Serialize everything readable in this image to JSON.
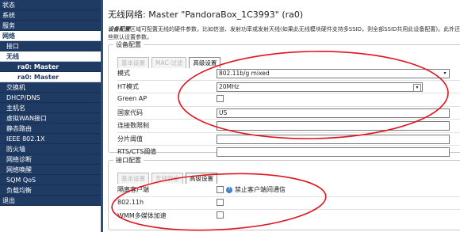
{
  "sidebar": {
    "items": [
      {
        "label": "状态",
        "level": 0,
        "state": "normal"
      },
      {
        "label": "系统",
        "level": 0,
        "state": "normal"
      },
      {
        "label": "服务",
        "level": 0,
        "state": "normal"
      },
      {
        "label": "网络",
        "level": 0,
        "state": "active"
      },
      {
        "label": "接口",
        "level": 1,
        "state": "normal"
      },
      {
        "label": "无线",
        "level": 1,
        "state": "active"
      },
      {
        "label": "ra0: Master",
        "level": 2,
        "state": "normal"
      },
      {
        "label": "ra0: Master",
        "level": 2,
        "state": "selected"
      },
      {
        "label": "交换机",
        "level": 1,
        "state": "normal"
      },
      {
        "label": "DHCP/DNS",
        "level": 1,
        "state": "normal"
      },
      {
        "label": "主机名",
        "level": 1,
        "state": "normal"
      },
      {
        "label": "虚拟WAN接口",
        "level": 1,
        "state": "normal"
      },
      {
        "label": "静态路由",
        "level": 1,
        "state": "normal"
      },
      {
        "label": "IEEE 802.1X",
        "level": 1,
        "state": "normal"
      },
      {
        "label": "防火墙",
        "level": 1,
        "state": "normal"
      },
      {
        "label": "网络诊断",
        "level": 1,
        "state": "normal"
      },
      {
        "label": "网络唤醒",
        "level": 1,
        "state": "normal"
      },
      {
        "label": "SQM QoS",
        "level": 1,
        "state": "normal"
      },
      {
        "label": "负载均衡",
        "level": 1,
        "state": "normal"
      },
      {
        "label": "退出",
        "level": 0,
        "state": "normal"
      }
    ]
  },
  "main": {
    "title": "无线网络: Master \"PandoraBox_1C3993\" (ra0)",
    "desc_bold": "设备配置",
    "desc": "区域可配置无线的硬件参数，比如信道、发射功率或发射天线(如果此无线模块硬件支持多SSID，则全部SSID共用此设备配置)。此外还有一些默认设置参数。",
    "device": {
      "legend": "设备配置",
      "tabs": [
        "基本设置",
        "MAC-过滤",
        "高级设置"
      ],
      "rows": [
        {
          "label": "模式",
          "value": "802.11b/g mixed"
        },
        {
          "label": "HT模式",
          "value": "20MHz"
        },
        {
          "label": "Green AP",
          "value": ""
        },
        {
          "label": "国家代码",
          "value": "US"
        },
        {
          "label": "连接数限制",
          "value": ""
        },
        {
          "label": "分片阈值",
          "value": ""
        },
        {
          "label": "RTS/CTS阈值",
          "value": ""
        }
      ]
    },
    "iface": {
      "legend": "接口配置",
      "tabs": [
        "基本设置",
        "无线安全",
        "高级设置"
      ],
      "rows": [
        {
          "label": "隔离客户端",
          "note": "禁止客户端间通信"
        },
        {
          "label": "802.11h",
          "note": ""
        },
        {
          "label": "WMM多媒体加速",
          "note": ""
        }
      ]
    }
  },
  "colors": {
    "sidebar_bg": "#1f3b63",
    "annotation": "#e0141e",
    "accent_border": "#2d4f7d"
  }
}
